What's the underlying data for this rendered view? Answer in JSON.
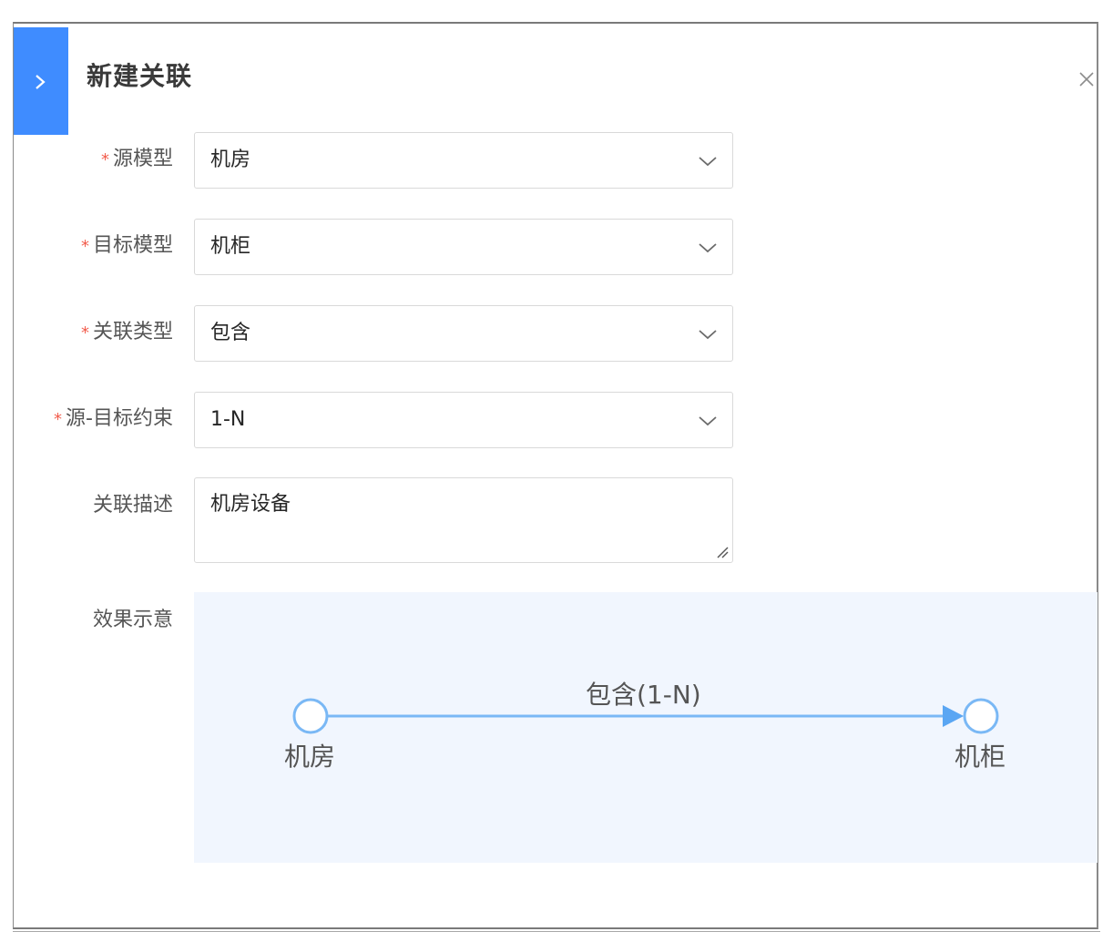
{
  "dialog": {
    "title": "新建关联",
    "collapse_icon": "chevron-right-icon",
    "close_icon": "close-icon"
  },
  "form": {
    "required_mark": "*",
    "source_model": {
      "label": "源模型",
      "value": "机房"
    },
    "target_model": {
      "label": "目标模型",
      "value": "机柜"
    },
    "relation_type": {
      "label": "关联类型",
      "value": "包含"
    },
    "constraint": {
      "label": "源-目标约束",
      "value": "1-N"
    },
    "description": {
      "label": "关联描述",
      "value": "机房设备"
    },
    "preview_label": "效果示意"
  },
  "preview": {
    "source_node": "机房",
    "target_node": "机柜",
    "edge_label": "包含(1-N)"
  },
  "colors": {
    "accent": "#3f8cff",
    "required": "#f25c4c",
    "edge": "#7ab8f5",
    "preview_bg": "#f1f6fe"
  }
}
